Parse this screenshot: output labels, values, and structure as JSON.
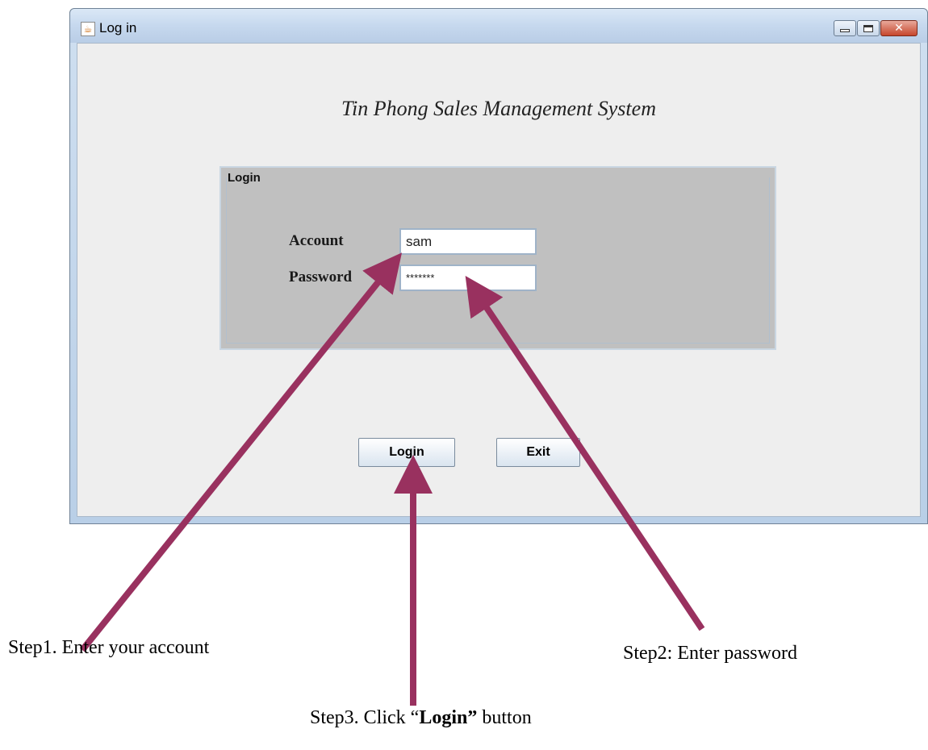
{
  "window": {
    "title": "Log in",
    "icon": "java-cup-icon",
    "controls": [
      "minimize",
      "maximize",
      "close"
    ]
  },
  "app_title": "Tin Phong Sales Management System",
  "login_panel": {
    "title": "Login",
    "account": {
      "label": "Account",
      "value": "sam"
    },
    "password": {
      "label": "Password",
      "value": "*******"
    }
  },
  "buttons": {
    "login": "Login",
    "exit": "Exit"
  },
  "annotations": {
    "step1": "Step1. Enter your account",
    "step2": "Step2: Enter password",
    "step3_prefix": "Step3. Click “",
    "step3_bold": "Login”",
    "step3_suffix": " button"
  },
  "colors": {
    "arrow": "#99315f",
    "panel": "#c0c0c0",
    "client": "#eeeeee"
  }
}
